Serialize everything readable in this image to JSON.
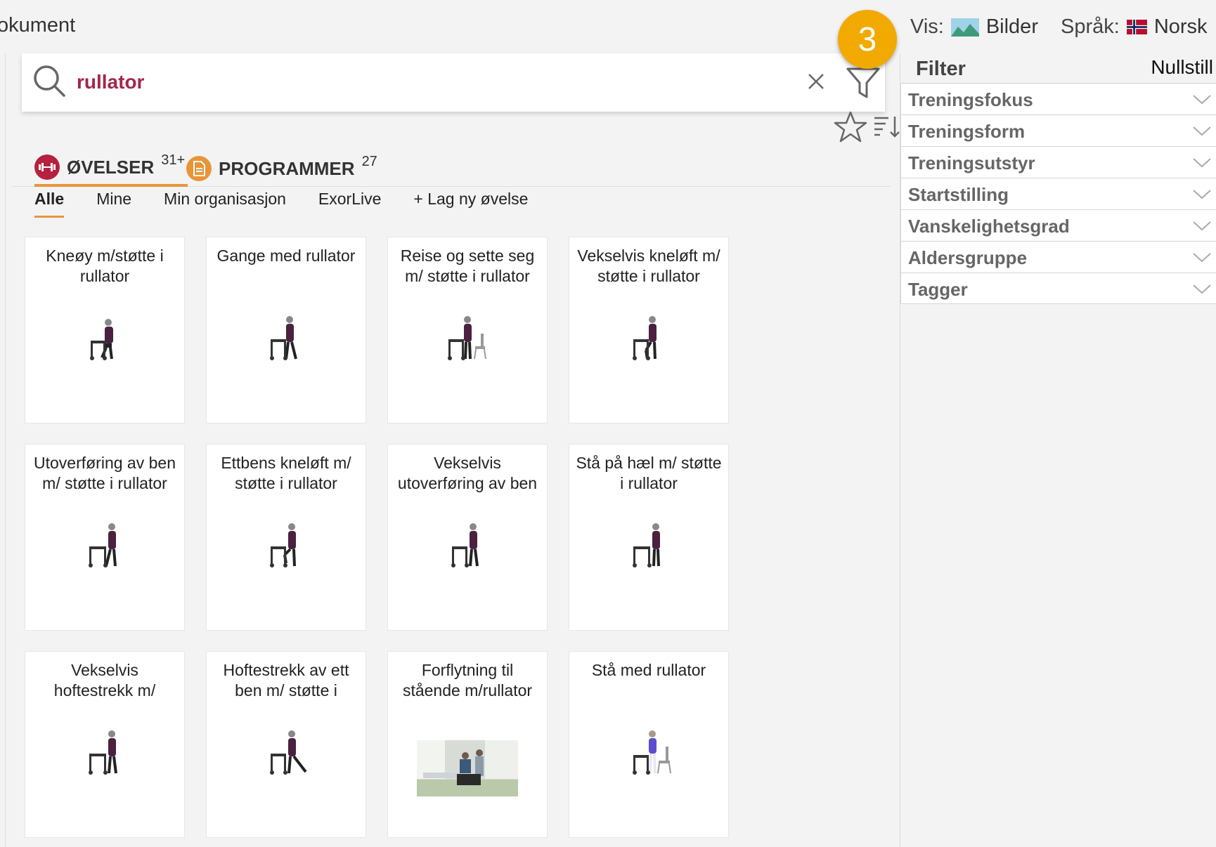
{
  "header": {
    "doc_title": "okument",
    "vis_label": "Vis:",
    "vis_value": "Bilder",
    "sprak_label": "Språk:",
    "sprak_value": "Norsk"
  },
  "badge": {
    "number": "3",
    "color": "#f2a900"
  },
  "search": {
    "value": "rullator",
    "value_color": "#a3264b"
  },
  "tabs": [
    {
      "label": "ØVELSER",
      "count": "31+",
      "icon": "dumbbell-icon",
      "color": "#b5213f"
    },
    {
      "label": "PROGRAMMER",
      "count": "27",
      "icon": "document-icon",
      "color": "#e8953a"
    }
  ],
  "subtabs": [
    "Alle",
    "Mine",
    "Min organisasjon",
    "ExorLive",
    "+ Lag ny øvelse"
  ],
  "cards": [
    {
      "title": "Kneøy m/støtte i rullator"
    },
    {
      "title": "Gange med rullator"
    },
    {
      "title": "Reise og sette seg m/ støtte i rullator"
    },
    {
      "title": "Vekselvis kneløft m/ støtte i rullator"
    },
    {
      "title": "Utoverføring av ben m/ støtte i rullator"
    },
    {
      "title": "Ettbens kneløft m/ støtte i rullator"
    },
    {
      "title": "Vekselvis utoverføring av ben"
    },
    {
      "title": "Stå på hæl m/ støtte i rullator"
    },
    {
      "title": "Vekselvis hoftestrekk m/"
    },
    {
      "title": "Hoftestrekk av ett ben m/ støtte i"
    },
    {
      "title": "Forflytning til stående m/rullator"
    },
    {
      "title": "Stå med rullator"
    }
  ],
  "filter": {
    "heading": "Filter",
    "reset": "Nullstill",
    "items": [
      "Treningsfokus",
      "Treningsform",
      "Treningsutstyr",
      "Startstilling",
      "Vanskelighetsgrad",
      "Aldersgruppe",
      "Tagger"
    ]
  }
}
